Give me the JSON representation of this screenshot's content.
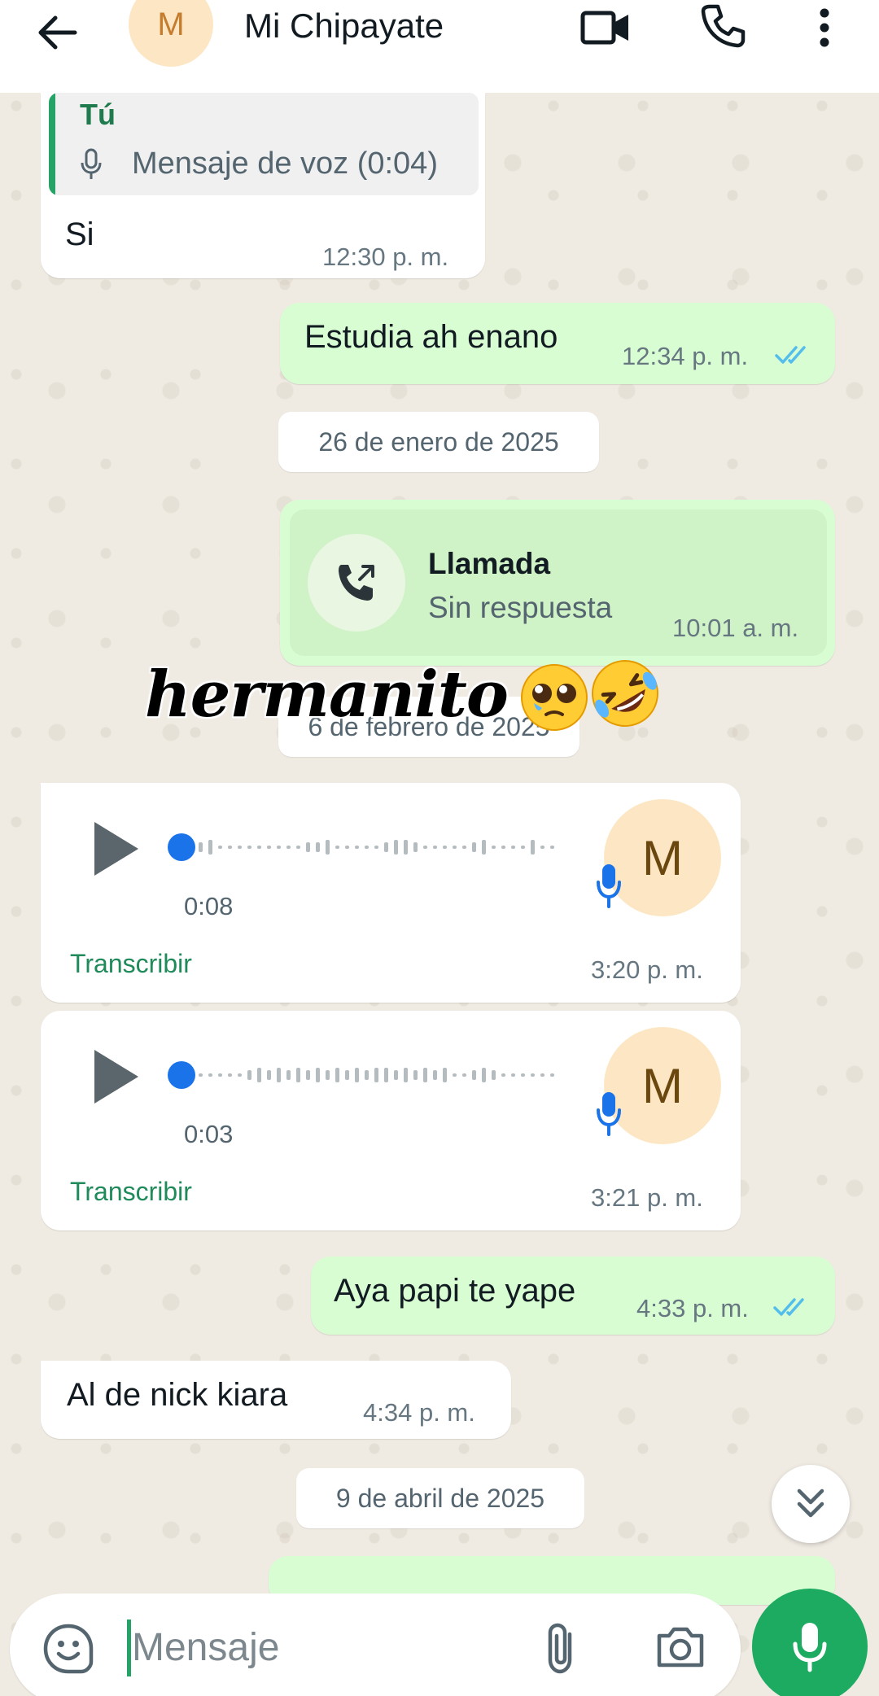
{
  "header": {
    "contact_initial": "M",
    "contact_name": "Mi Chipayate"
  },
  "messages": {
    "m1": {
      "quote_author": "Tú",
      "quote_text": "Mensaje de voz (0:04)",
      "text": "Si",
      "time": "12:30 p. m."
    },
    "m2": {
      "text": "Estudia ah enano",
      "time": "12:34 p. m.",
      "status": "read"
    },
    "date1": "26 de enero de 2025",
    "call": {
      "title": "Llamada",
      "subtitle": "Sin respuesta",
      "time": "10:01 a. m."
    },
    "date2": "6 de febrero de 2025",
    "voice1": {
      "duration": "0:08",
      "avatar_initial": "M",
      "transcribe": "Transcribir",
      "time": "3:20 p. m.",
      "progress": 0
    },
    "voice2": {
      "duration": "0:03",
      "avatar_initial": "M",
      "transcribe": "Transcribir",
      "time": "3:21 p. m.",
      "progress": 0
    },
    "m3": {
      "text": "Aya papi te yape",
      "time": "4:33 p. m.",
      "status": "read"
    },
    "m4": {
      "text": "Al de nick kiara",
      "time": "4:34 p. m."
    },
    "date3": "9 de abril de 2025"
  },
  "overlay": {
    "text": "hermanito",
    "emojis": [
      "pleading-face-with-tear",
      "rolling-on-floor-laughing"
    ]
  },
  "composer": {
    "placeholder": "Mensaje"
  },
  "colors": {
    "outgoing_bubble": "#d9fdd3",
    "incoming_bubble": "#ffffff",
    "accent_green": "#1daa61",
    "read_ticks": "#53bdeb",
    "voice_dot": "#1a73e8",
    "avatar_bg": "#fde6c4"
  },
  "icons": [
    "back-arrow-icon",
    "video-call-icon",
    "phone-icon",
    "more-vert-icon",
    "mic-icon",
    "missed-call-icon",
    "play-icon",
    "double-check-icon",
    "chevron-double-down-icon",
    "sticker-icon",
    "attach-icon",
    "camera-icon"
  ]
}
